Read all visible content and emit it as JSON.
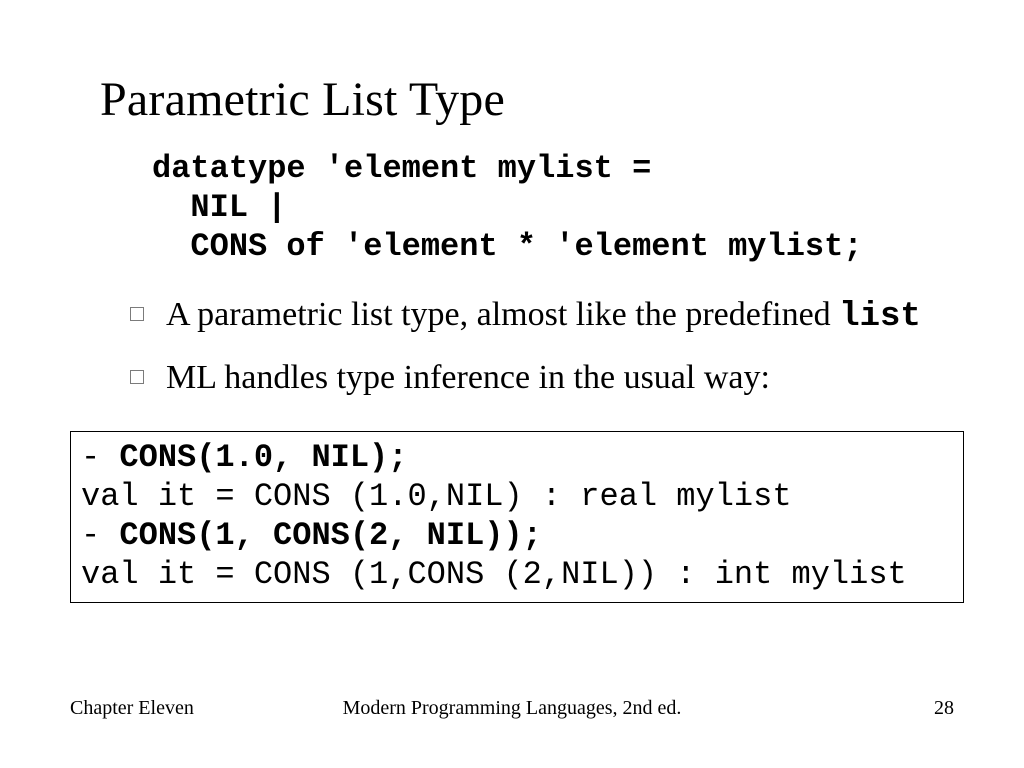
{
  "title": "Parametric List Type",
  "code": {
    "line1": "datatype 'element mylist =",
    "line2": "  NIL |",
    "line3": "  CONS of 'element * 'element mylist;"
  },
  "bullets": [
    {
      "pre": "A parametric list type, almost like the predefined ",
      "mono": "list",
      "post": ""
    },
    {
      "pre": "ML handles type inference in the usual way:",
      "mono": "",
      "post": ""
    }
  ],
  "box": {
    "l1_prompt": "- ",
    "l1_bold": "CONS(1.0, NIL);",
    "l2": "val it = CONS (1.0,NIL) : real mylist",
    "l3_prompt": "- ",
    "l3_bold": "CONS(1, CONS(2, NIL));",
    "l4": "val it = CONS (1,CONS (2,NIL)) : int mylist"
  },
  "footer": {
    "left": "Chapter Eleven",
    "center": "Modern Programming Languages, 2nd ed.",
    "right": "28"
  }
}
